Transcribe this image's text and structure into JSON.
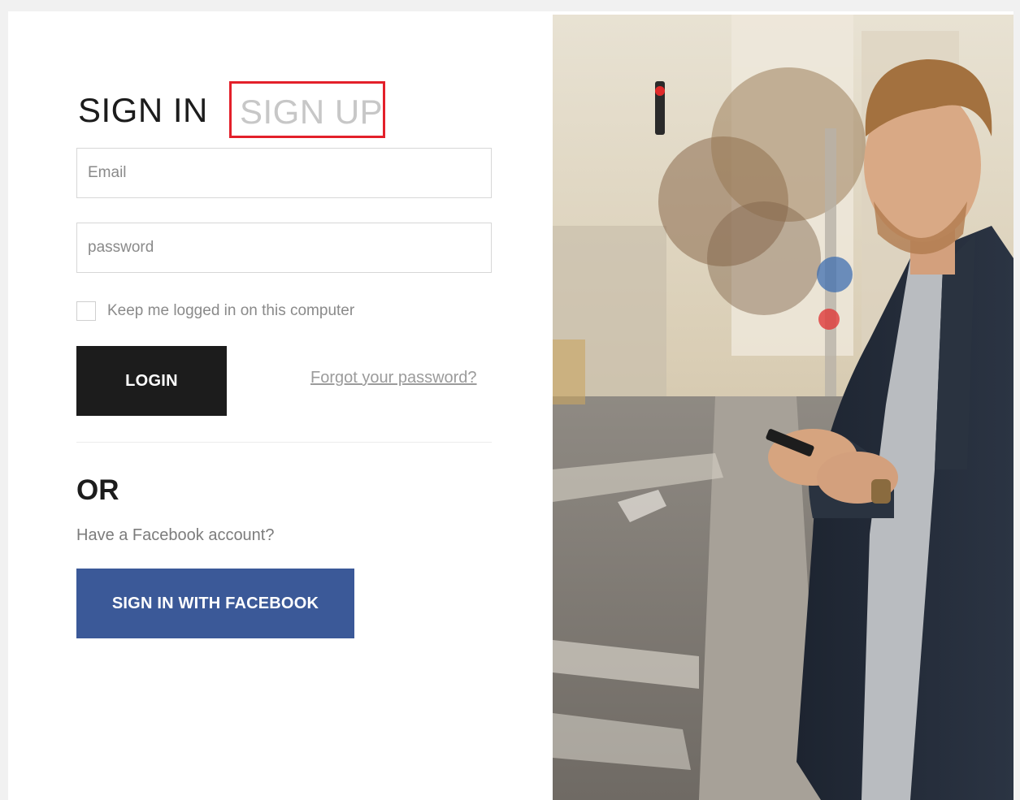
{
  "tabs": {
    "signin": "SIGN IN",
    "signup": "SIGN UP"
  },
  "form": {
    "email_placeholder": "Email",
    "password_placeholder": "password",
    "remember_label": "Keep me logged in on this computer",
    "login_label": "LOGIN",
    "forgot_label": "Forgot your password?"
  },
  "alt": {
    "or_label": "OR",
    "facebook_question": "Have a Facebook account?",
    "facebook_button": "SIGN IN WITH FACEBOOK"
  },
  "colors": {
    "highlight_box": "#e3202a",
    "login_button": "#1c1c1c",
    "facebook_button": "#3b5998"
  },
  "photo": {
    "subject": "man-using-phone-on-street"
  }
}
